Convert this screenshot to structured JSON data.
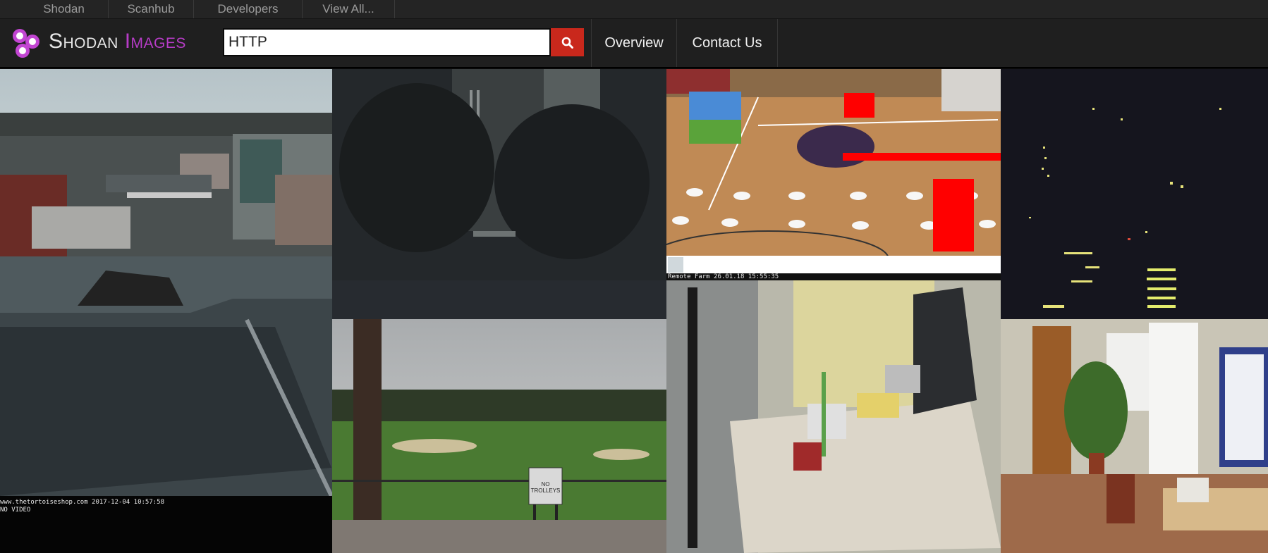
{
  "topbar": {
    "links": [
      "Shodan",
      "Scanhub",
      "Developers",
      "View All..."
    ]
  },
  "header": {
    "logo_main": "Shodan ",
    "logo_accent": "Images",
    "search": {
      "value": "HTTP",
      "icon": "search-icon"
    },
    "nav": [
      "Overview",
      "Contact Us"
    ]
  },
  "colors": {
    "accent": "#b73cc7",
    "search_button": "#c9281c",
    "background": "#0b0b0b"
  },
  "images": [
    {
      "subject": "city skyline webcam"
    },
    {
      "subject": "dark interior camera"
    },
    {
      "subject": "basketball court camera",
      "caption": "Remote Farm 26.01.18 15:55:35"
    },
    {
      "subject": "night city lights camera"
    },
    {
      "subject": "dark overhang camera",
      "caption": "www.thetortoiseshop.com 2017-12-04 10:57:58",
      "caption2": "NO VIDEO"
    },
    {
      "subject": "golf course camera",
      "sign": "NO TROLLEYS"
    },
    {
      "subject": "laboratory bench camera"
    },
    {
      "subject": "office hallway camera"
    }
  ]
}
